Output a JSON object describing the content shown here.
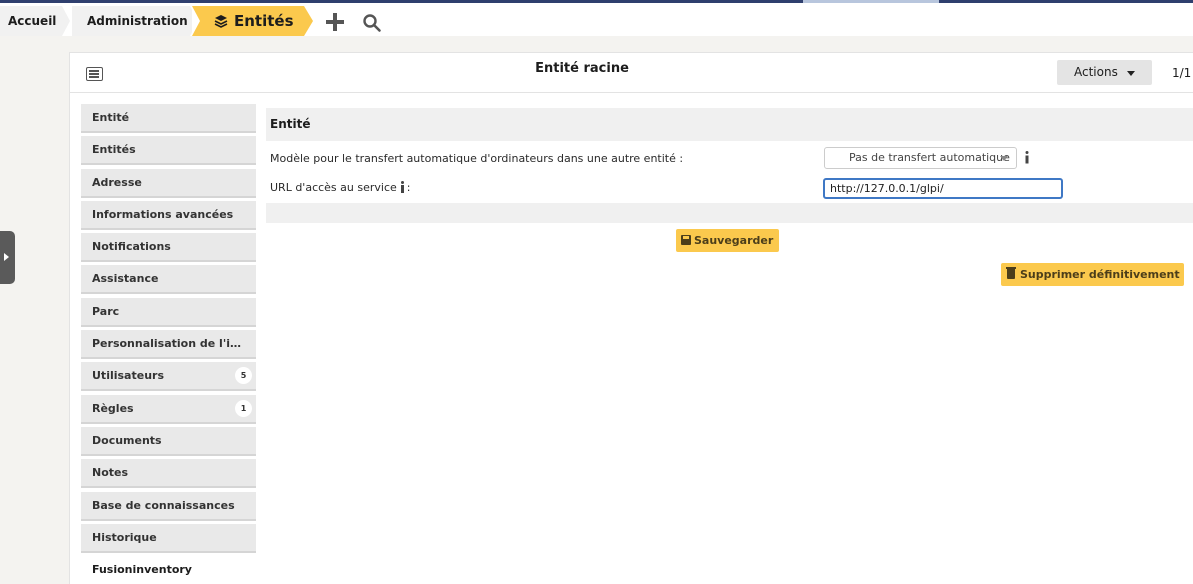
{
  "breadcrumb": {
    "items": [
      "Accueil",
      "Administration"
    ],
    "current": "Entités"
  },
  "header": {
    "title": "Entité racine",
    "actions_label": "Actions",
    "pager": "1/1"
  },
  "tabs": [
    {
      "label": "Entité",
      "badge": ""
    },
    {
      "label": "Entités",
      "badge": ""
    },
    {
      "label": "Adresse",
      "badge": ""
    },
    {
      "label": "Informations avancées",
      "badge": ""
    },
    {
      "label": "Notifications",
      "badge": ""
    },
    {
      "label": "Assistance",
      "badge": ""
    },
    {
      "label": "Parc",
      "badge": ""
    },
    {
      "label": "Personnalisation de l'interf…",
      "badge": ""
    },
    {
      "label": "Utilisateurs",
      "badge": "5"
    },
    {
      "label": "Règles",
      "badge": "1"
    },
    {
      "label": "Documents",
      "badge": ""
    },
    {
      "label": "Notes",
      "badge": ""
    },
    {
      "label": "Base de connaissances",
      "badge": ""
    },
    {
      "label": "Historique",
      "badge": ""
    },
    {
      "label": "Fusioninventory",
      "badge": ""
    }
  ],
  "active_tab": "Fusioninventory",
  "form": {
    "section_title": "Entité",
    "transfer_label": "Modèle pour le transfert automatique d'ordinateurs dans une autre entité :",
    "transfer_value": "Pas de transfert automatique",
    "url_label": "URL d'accès au service",
    "url_suffix": ":",
    "url_value": "http://127.0.0.1/glpi/",
    "save_label": "Sauvegarder",
    "delete_label": "Supprimer définitivement"
  },
  "colors": {
    "accent": "#fbc94d",
    "topbar": "#2f3f6e",
    "focus": "#3f78c5"
  }
}
